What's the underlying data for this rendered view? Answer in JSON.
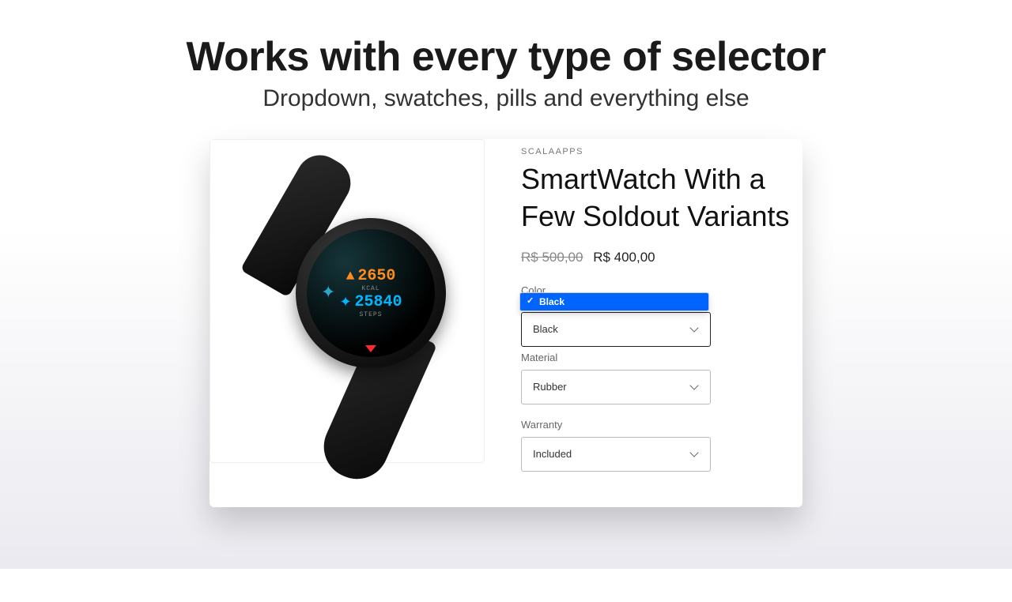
{
  "headline": "Works with every type of selector",
  "subhead": "Dropdown, swatches, pills and everything else",
  "brand": "SCALAAPPS",
  "product_title": "SmartWatch With a Few Soldout Variants",
  "price_compare": "R$ 500,00",
  "price": "R$ 400,00",
  "watch": {
    "kcal_value": "2650",
    "kcal_label": "KCAL",
    "steps_value": "25840",
    "steps_label": "STEPS"
  },
  "options": {
    "color": {
      "label": "Color",
      "value": "Black",
      "open_item": "Black"
    },
    "material": {
      "label": "Material",
      "value": "Rubber"
    },
    "warranty": {
      "label": "Warranty",
      "value": "Included"
    }
  }
}
